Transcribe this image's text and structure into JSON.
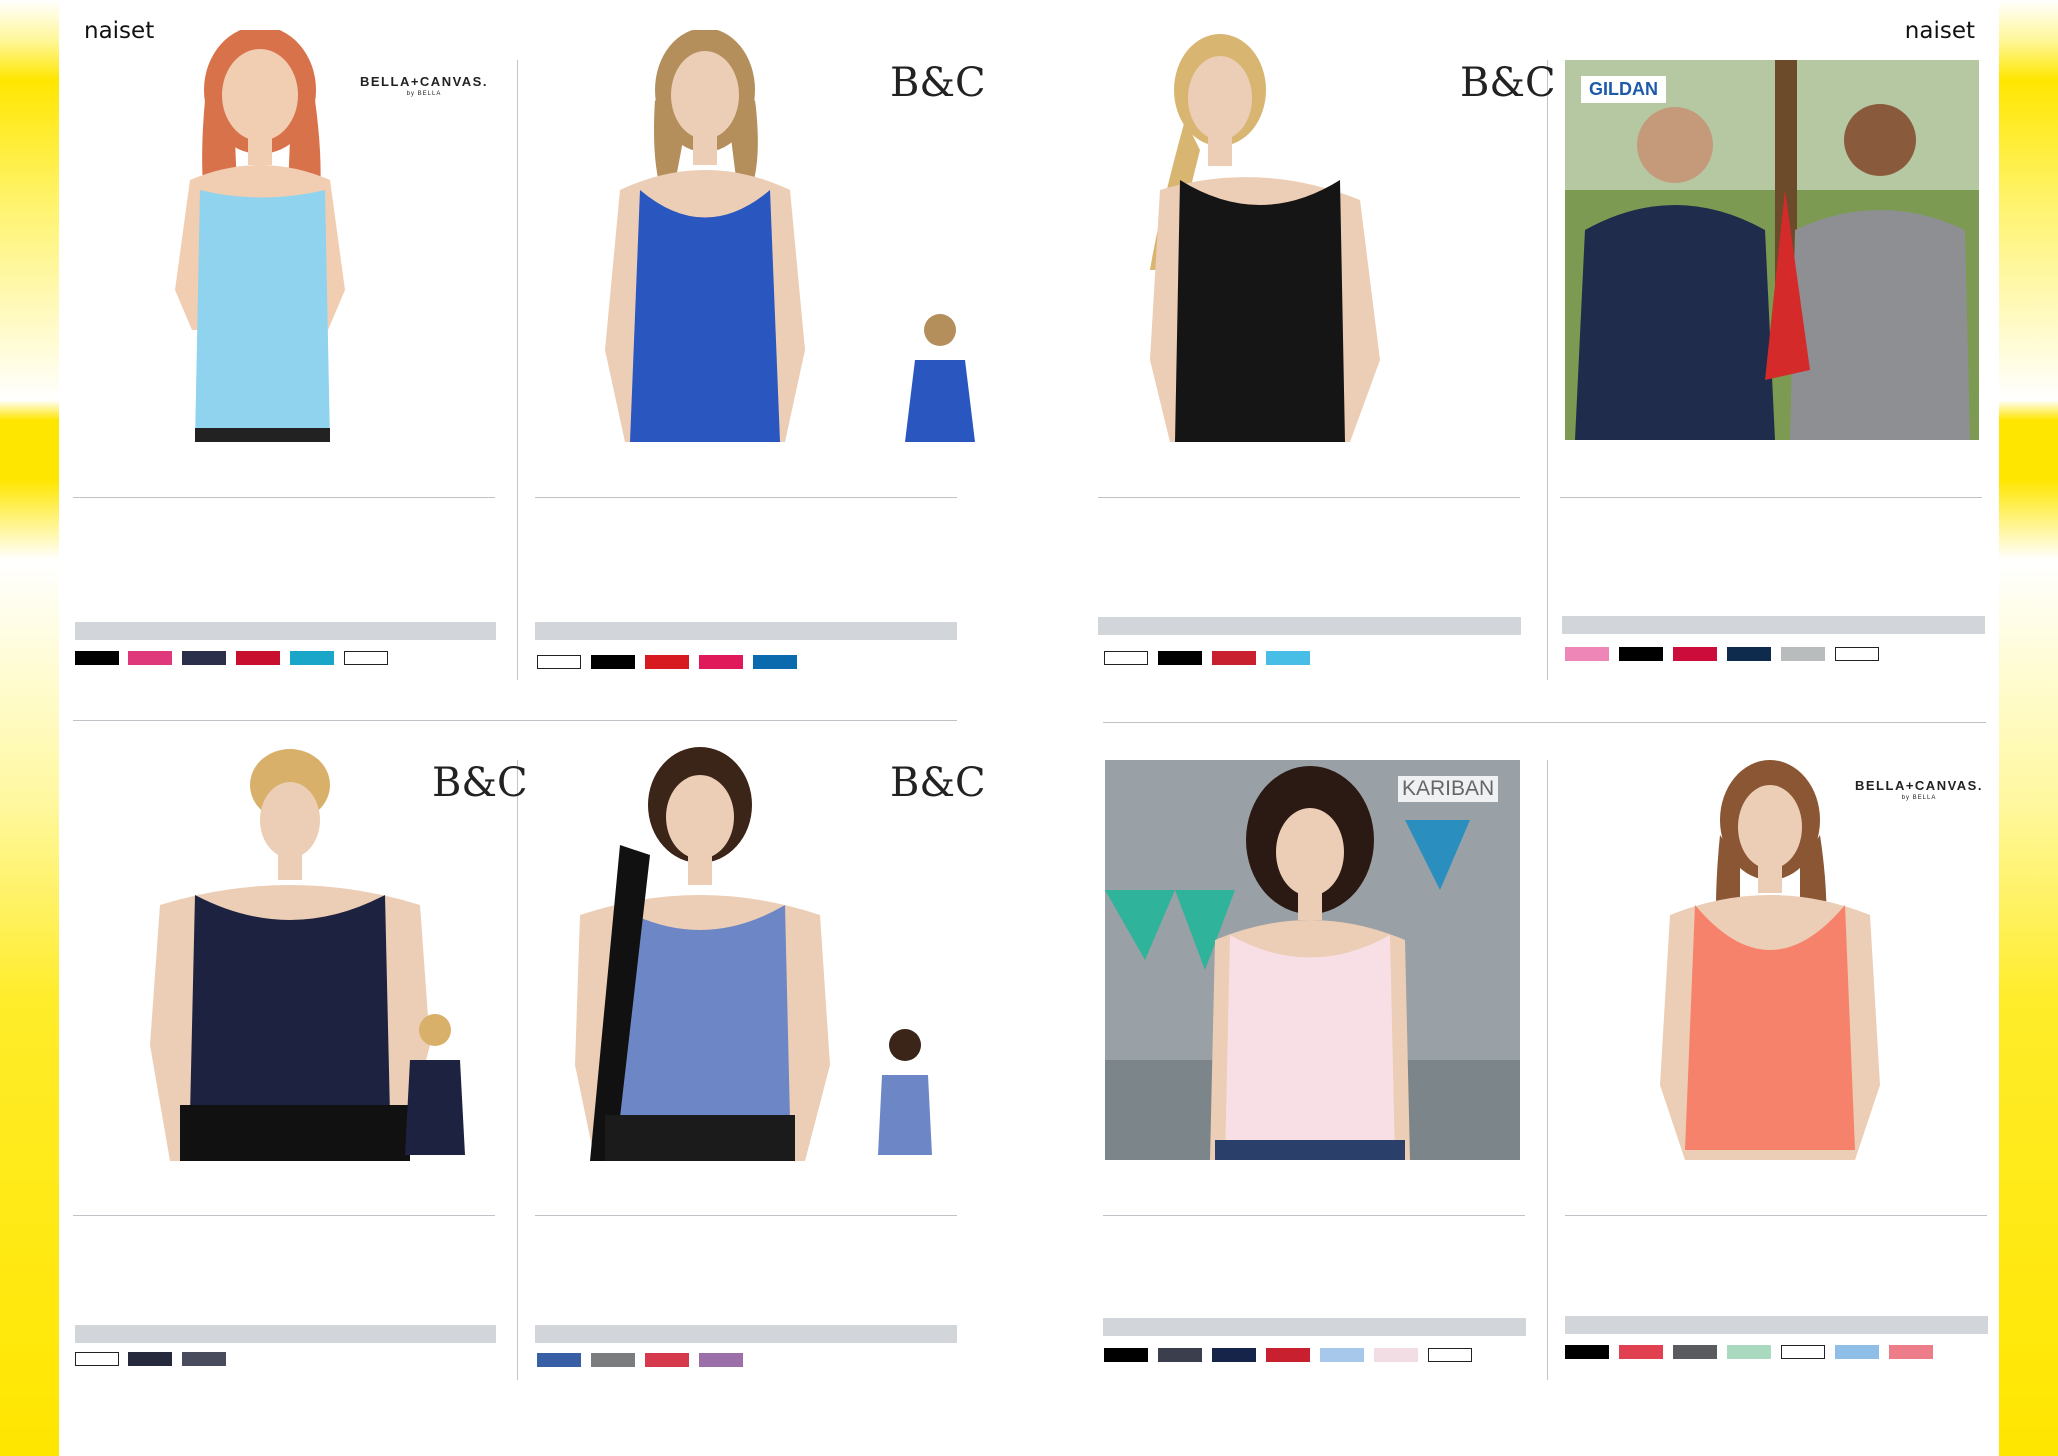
{
  "header": {
    "left_label": "naiset",
    "right_label": "naiset"
  },
  "products": [
    {
      "brand": "BELLA+CANVAS.",
      "brand_sub": "by BELLA",
      "shirt_color": "#8fd3ee",
      "swatches": [
        "#000000",
        "#e0397b",
        "#2b2f4a",
        "#c8102e",
        "#1aa6c8",
        "outline"
      ]
    },
    {
      "brand": "B&C",
      "shirt_color": "#2a56c0",
      "swatches": [
        "outline",
        "#000000",
        "#d71920",
        "#e0195a",
        "#0b6aae"
      ]
    },
    {
      "brand": "B&C",
      "shirt_color": "#151515",
      "swatches": [
        "outline",
        "#000000",
        "#c8202f",
        "#48bde6"
      ]
    },
    {
      "brand": "GILDAN",
      "shirt_color": "#8e8f93",
      "swatches": [
        "#ee86b8",
        "#000000",
        "#cc0c3b",
        "#0e2a4d",
        "#b8bcbc",
        "outline"
      ]
    },
    {
      "brand": "B&C",
      "shirt_color": "#1d2240",
      "swatches": [
        "outline",
        "#25293b",
        "#484b5c"
      ]
    },
    {
      "brand": "B&C",
      "shirt_color": "#6d86c6",
      "swatches": [
        "#385ea6",
        "#7b7c7e",
        "#d5394c",
        "#9a6faa"
      ]
    },
    {
      "brand": "KARIBAN",
      "shirt_color": "#f8dfe6",
      "swatches": [
        "#000000",
        "#3b3e4d",
        "#16244a",
        "#c8202f",
        "#a7c8ea",
        "#f3dde4",
        "outline"
      ]
    },
    {
      "brand": "BELLA+CANVAS.",
      "brand_sub": "by BELLA",
      "shirt_color": "#f7826b",
      "swatches": [
        "#000000",
        "#e0404f",
        "#5a5b5f",
        "#a9d9be",
        "outline",
        "#8fbfe6",
        "#ee7d8a"
      ]
    }
  ]
}
